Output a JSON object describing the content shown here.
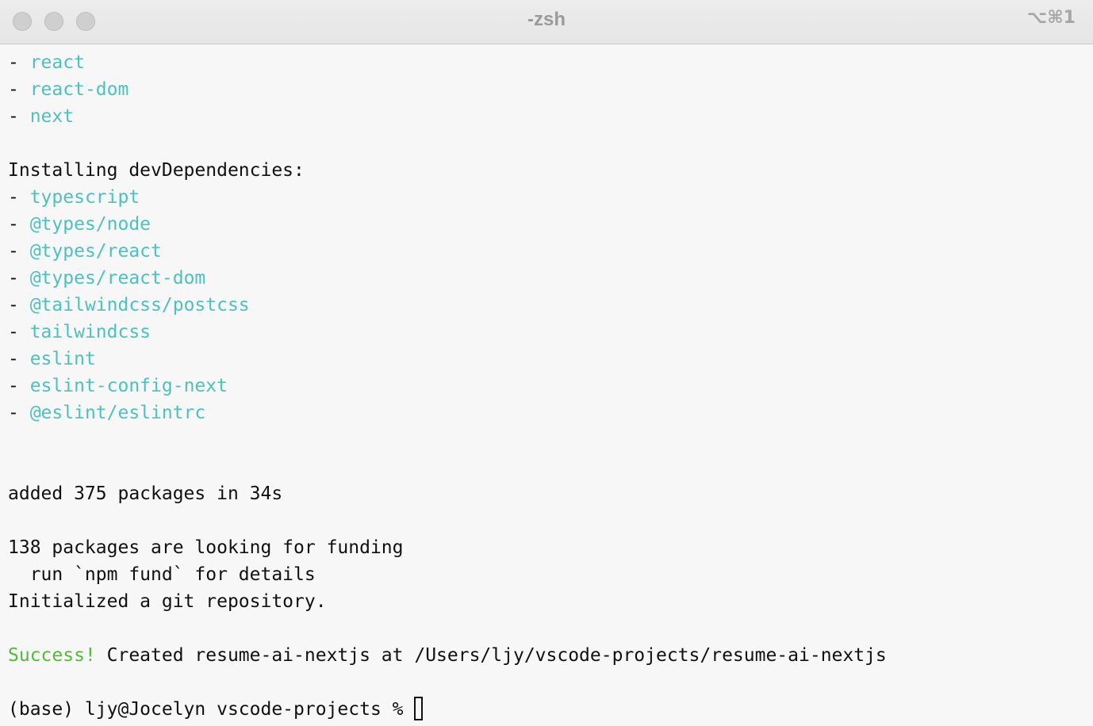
{
  "window": {
    "title": "-zsh",
    "shortcut": "⌥⌘1"
  },
  "terminal": {
    "dependencies": [
      "react",
      "react-dom",
      "next"
    ],
    "dev_header": "Installing devDependencies:",
    "dev_dependencies": [
      "typescript",
      "@types/node",
      "@types/react",
      "@types/react-dom",
      "@tailwindcss/postcss",
      "tailwindcss",
      "eslint",
      "eslint-config-next",
      "@eslint/eslintrc"
    ],
    "bullet": "- ",
    "added": "added 375 packages in 34s",
    "funding": "138 packages are looking for funding",
    "fund_hint": "  run `npm fund` for details",
    "git_init": "Initialized a git repository.",
    "success_label": "Success!",
    "success_text": " Created resume-ai-nextjs at /Users/ljy/vscode-projects/resume-ai-nextjs",
    "prompt": "(base) ljy@Jocelyn vscode-projects % "
  },
  "colors": {
    "package": "#4cc2be",
    "success": "#52bb3a",
    "text": "#111111",
    "background": "#f7f7f7"
  }
}
